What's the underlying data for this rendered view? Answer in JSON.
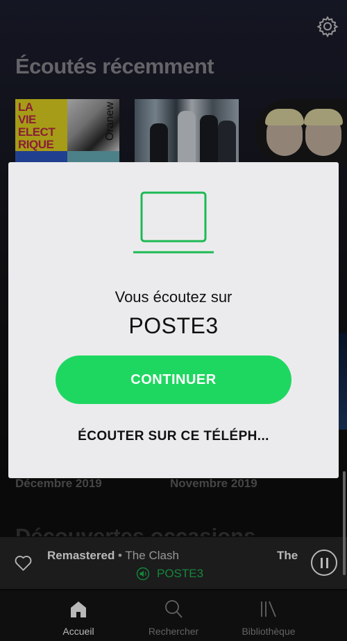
{
  "home": {
    "section_title": "Écoutés récemment",
    "album1_lines": [
      "LA",
      "VIE",
      "ELECT",
      "RIQUE"
    ],
    "album1_vertical": "Oranew",
    "month_left": "Décembre 2019",
    "month_right": "Novembre 2019",
    "next_section_title": "Découvertes occasions"
  },
  "mini_player": {
    "track_title": "Remastered",
    "separator": " • ",
    "artist": "The Clash",
    "next_track": "The",
    "device": "POSTE3"
  },
  "nav": {
    "items": [
      {
        "label": "Accueil",
        "icon": "home-icon",
        "active": true
      },
      {
        "label": "Rechercher",
        "icon": "search-icon",
        "active": false
      },
      {
        "label": "Bibliothèque",
        "icon": "library-icon",
        "active": false
      }
    ]
  },
  "modal": {
    "subtitle": "Vous écoutez sur",
    "device_name": "POSTE3",
    "continue_label": "CONTINUER",
    "listen_here_label": "ÉCOUTER SUR CE TÉLÉPH..."
  },
  "colors": {
    "accent": "#1ed760",
    "modal_bg": "#ebebed",
    "background": "#121212"
  }
}
